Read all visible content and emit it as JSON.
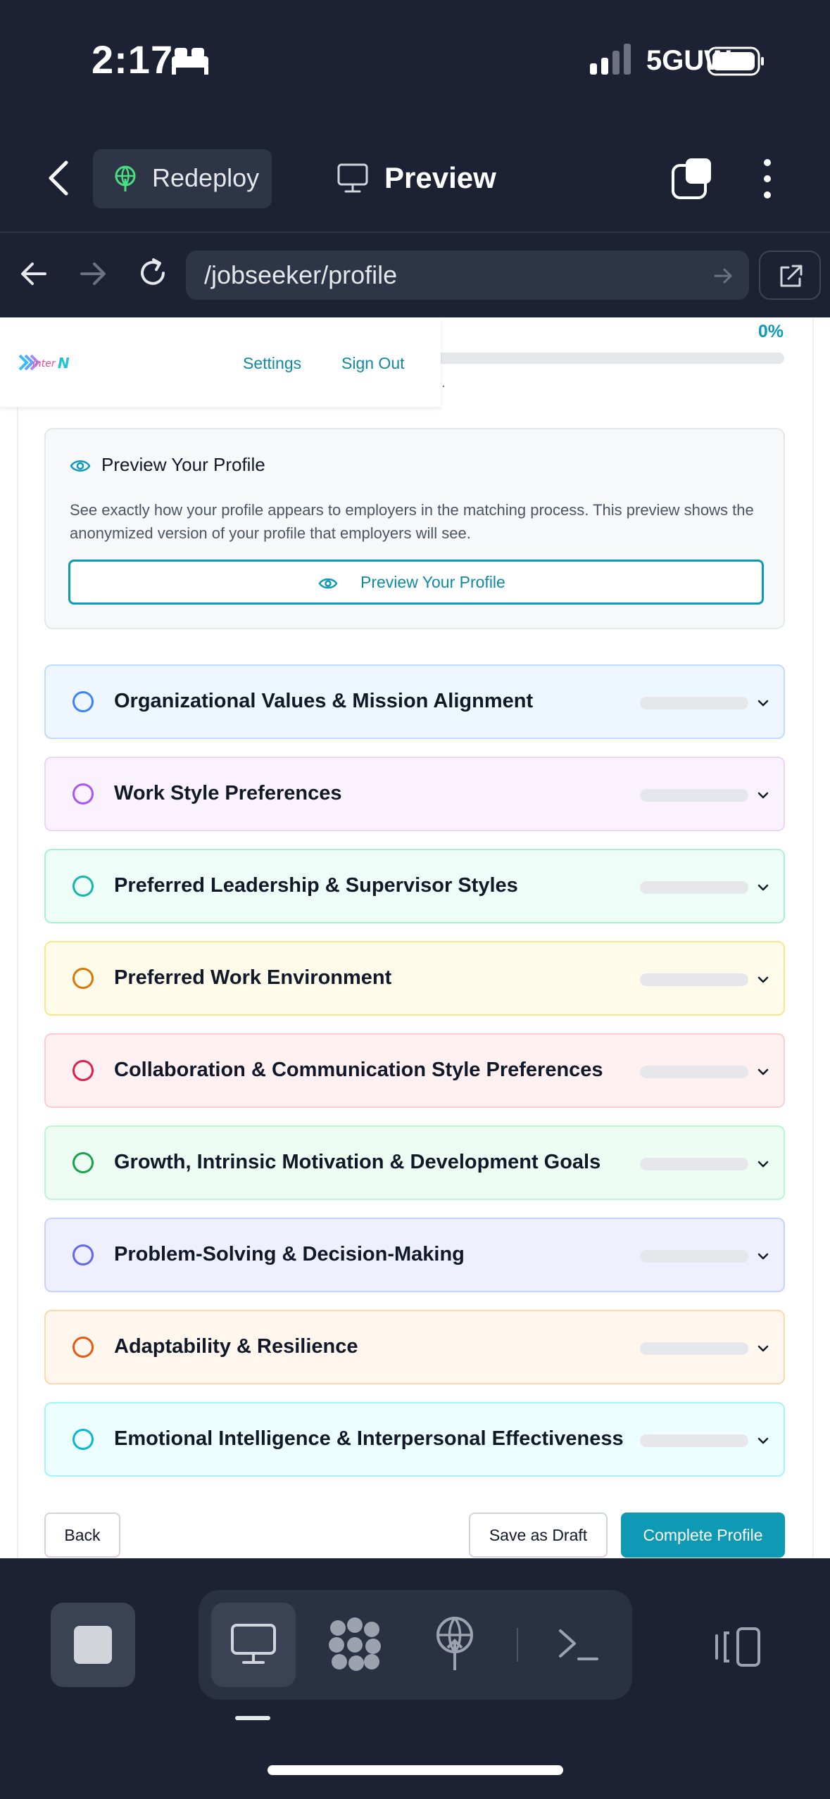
{
  "status_bar": {
    "time": "2:17",
    "network": "5GUW"
  },
  "app_bar": {
    "redeploy_label": "Redeploy",
    "preview_label": "Preview"
  },
  "browser": {
    "url": "/jobseeker/profile"
  },
  "site": {
    "logo_text": "InterN",
    "nav": {
      "settings": "Settings",
      "sign_out": "Sign Out"
    },
    "progress_percent": "0%",
    "progress_value": 0,
    "behind_header_text": "e."
  },
  "preview_card": {
    "title": "Preview Your Profile",
    "description": "See exactly how your profile appears to employers in the matching process. This preview shows the anonymized version of your profile that employers will see.",
    "button_label": "Preview Your Profile"
  },
  "sections": [
    {
      "title": "Organizational Values & Mission Alignment",
      "bg": "#eef6ff",
      "border": "#bfdbfe",
      "accent": "#3b82f6",
      "progress": 0
    },
    {
      "title": "Work Style Preferences",
      "bg": "#faf3ff",
      "border": "#e9d5ff",
      "accent": "#a855f7",
      "progress": 0
    },
    {
      "title": "Preferred Leadership & Supervisor Styles",
      "bg": "#eefdf8",
      "border": "#a7f3d0",
      "accent": "#14b8a6",
      "progress": 0
    },
    {
      "title": "Preferred Work Environment",
      "bg": "#fffbeb",
      "border": "#fde68a",
      "accent": "#d97706",
      "progress": 0
    },
    {
      "title": "Collaboration & Communication Style Preferences",
      "bg": "#fff1f2",
      "border": "#fecdd3",
      "accent": "#e11d48",
      "progress": 0
    },
    {
      "title": "Growth, Intrinsic Motivation & Development Goals",
      "bg": "#edfdf3",
      "border": "#bbf7d0",
      "accent": "#16a34a",
      "progress": 0
    },
    {
      "title": "Problem-Solving & Decision-Making",
      "bg": "#eef0ff",
      "border": "#c7d2fe",
      "accent": "#6366f1",
      "progress": 0
    },
    {
      "title": "Adaptability & Resilience",
      "bg": "#fff6ed",
      "border": "#fed7aa",
      "accent": "#ea580c",
      "progress": 0
    },
    {
      "title": "Emotional Intelligence & Interpersonal Effectiveness",
      "bg": "#ecfeff",
      "border": "#a5f3fc",
      "accent": "#06b6d4",
      "progress": 0
    }
  ],
  "actions": {
    "back": "Back",
    "save_draft": "Save as Draft",
    "complete": "Complete Profile"
  },
  "colors": {
    "accent": "#0e9ab4",
    "chrome_bg": "#1c2233"
  }
}
